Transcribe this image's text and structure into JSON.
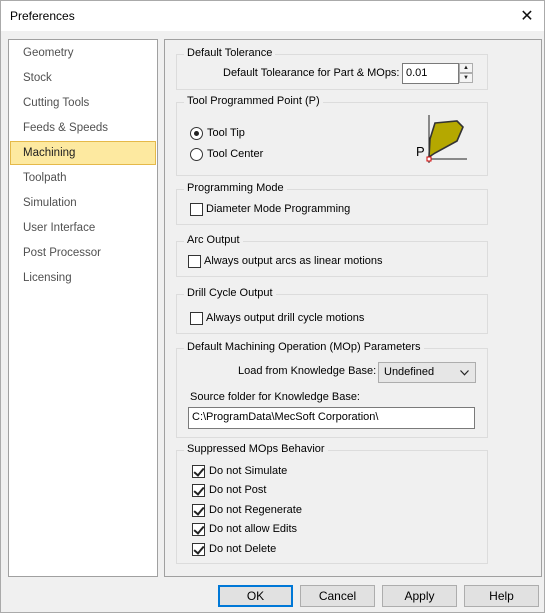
{
  "window": {
    "title": "Preferences",
    "close_glyph": "✕"
  },
  "sidebar": {
    "items": [
      {
        "label": "Geometry",
        "selected": false
      },
      {
        "label": "Stock",
        "selected": false
      },
      {
        "label": "Cutting Tools",
        "selected": false
      },
      {
        "label": "Feeds & Speeds",
        "selected": false
      },
      {
        "label": "Machining",
        "selected": true
      },
      {
        "label": "Toolpath",
        "selected": false
      },
      {
        "label": "Simulation",
        "selected": false
      },
      {
        "label": "User Interface",
        "selected": false
      },
      {
        "label": "Post Processor",
        "selected": false
      },
      {
        "label": "Licensing",
        "selected": false
      }
    ]
  },
  "default_tolerance": {
    "title": "Default Tolerance",
    "label": "Default Tolearance for Part & MOps:",
    "value": "0.01"
  },
  "tool_point": {
    "title": "Tool Programmed Point (P)",
    "options": [
      {
        "label": "Tool Tip",
        "checked": true
      },
      {
        "label": "Tool Center",
        "checked": false
      }
    ],
    "diagram_label": "P",
    "diagram_fill": "#b5a800"
  },
  "programming_mode": {
    "title": "Programming Mode",
    "checkbox": {
      "label": "Diameter Mode Programming",
      "checked": false
    }
  },
  "arc_output": {
    "title": "Arc Output",
    "checkbox": {
      "label": "Always output arcs as linear motions",
      "checked": false
    }
  },
  "drill_cycle": {
    "title": "Drill Cycle Output",
    "checkbox": {
      "label": "Always output drill cycle motions",
      "checked": false
    }
  },
  "mop_params": {
    "title": "Default Machining Operation (MOp) Parameters",
    "load_label": "Load from Knowledge Base:",
    "load_value": "Undefined",
    "source_label": "Source folder for Knowledge Base:",
    "source_value": "C:\\ProgramData\\MecSoft Corporation\\"
  },
  "suppressed": {
    "title": "Suppressed MOps Behavior",
    "items": [
      {
        "label": "Do not Simulate",
        "checked": true
      },
      {
        "label": "Do not Post",
        "checked": true
      },
      {
        "label": "Do not Regenerate",
        "checked": true
      },
      {
        "label": "Do not allow Edits",
        "checked": true
      },
      {
        "label": "Do not Delete",
        "checked": true
      }
    ]
  },
  "buttons": {
    "ok": "OK",
    "cancel": "Cancel",
    "apply": "Apply",
    "help": "Help"
  },
  "colors": {
    "selection_bg": "#fde9a0",
    "selection_border": "#e5b949",
    "focus_border": "#0078d7"
  }
}
